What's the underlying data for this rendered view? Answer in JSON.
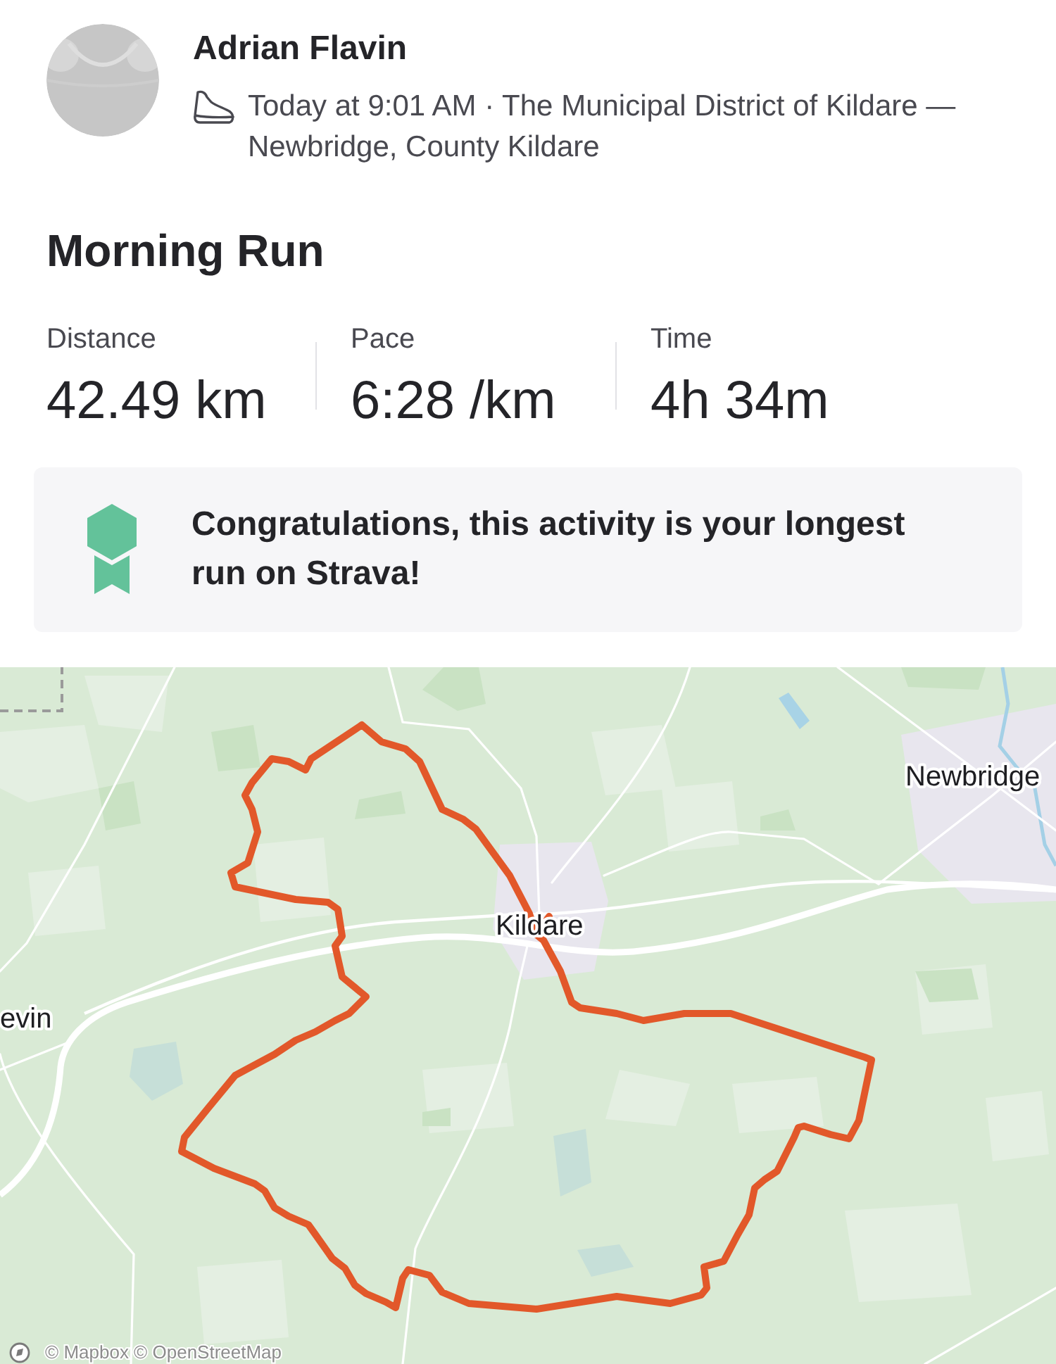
{
  "athlete": {
    "name": "Adrian Flavin",
    "meta": "Today at 9:01 AM · The Municipal District of Kildare — Newbridge, County Kildare"
  },
  "activity": {
    "title": "Morning Run",
    "stats": [
      {
        "label": "Distance",
        "value": "42.49 km"
      },
      {
        "label": "Pace",
        "value": "6:28 /km"
      },
      {
        "label": "Time",
        "value": "4h 34m"
      }
    ]
  },
  "achievement": {
    "message": "Congratulations, this activity is your longest run on Strava!"
  },
  "map": {
    "place_labels": [
      "Newbridge",
      "Kildare",
      "evin"
    ],
    "attribution": "© Mapbox © OpenStreetMap"
  }
}
